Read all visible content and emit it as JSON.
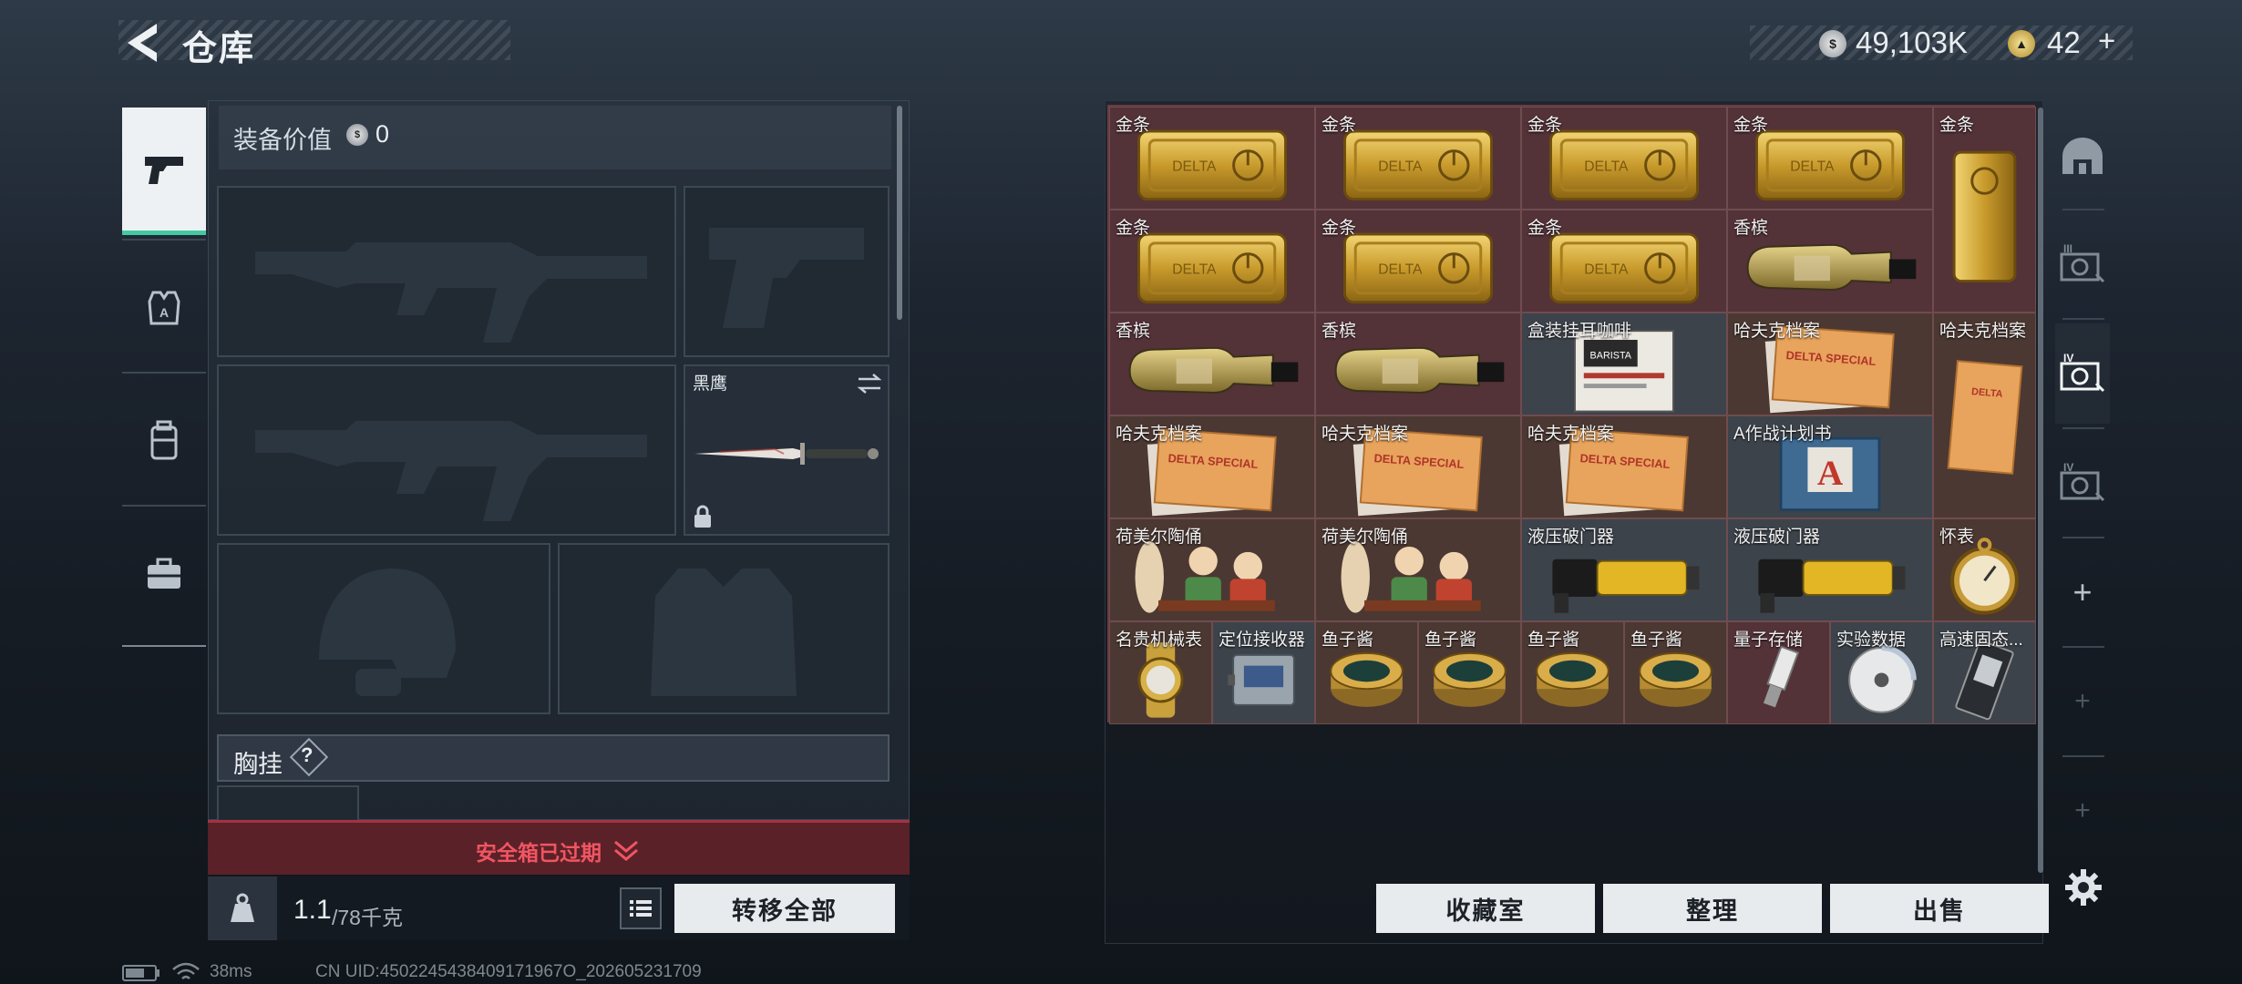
{
  "header": {
    "title": "仓库",
    "currency_1": "49,103K",
    "currency_2": "42",
    "currency_2_suffix": "+"
  },
  "left_tabs": [
    "pistol-icon",
    "vest-icon",
    "backpack-icon",
    "case-icon"
  ],
  "equipment": {
    "value_label": "装备价值",
    "value": "0",
    "melee_name": "黑鹰",
    "chest_rig_label": "胸挂",
    "chest_rig_help": "?"
  },
  "safe_box": {
    "status": "安全箱已过期"
  },
  "weight": {
    "current": "1.1",
    "max": "/78千克"
  },
  "buttons": {
    "transfer_all": "转移全部",
    "collection": "收藏室",
    "sort": "整理",
    "sell": "出售"
  },
  "status_bar": {
    "ping": "38ms",
    "uid": "CN UID:4502245438409171967O_202605231709"
  },
  "storage_items": [
    {
      "name": "金条",
      "art": "goldbar"
    },
    {
      "name": "金条",
      "art": "goldbar"
    },
    {
      "name": "金条",
      "art": "goldbar"
    },
    {
      "name": "金条",
      "art": "goldbar"
    },
    {
      "name": "金条",
      "art": "goldbar-v"
    },
    {
      "name": "金条",
      "art": "goldbar"
    },
    {
      "name": "金条",
      "art": "goldbar"
    },
    {
      "name": "金条",
      "art": "goldbar"
    },
    {
      "name": "香槟",
      "art": "bottle"
    },
    {
      "name": "香槟",
      "art": "bottle"
    },
    {
      "name": "香槟",
      "art": "bottle"
    },
    {
      "name": "盒装挂耳咖啡",
      "art": "coffee"
    },
    {
      "name": "哈夫克档案",
      "art": "folder"
    },
    {
      "name": "哈夫克档案",
      "art": "folder-v"
    },
    {
      "name": "哈夫克档案",
      "art": "folder"
    },
    {
      "name": "哈夫克档案",
      "art": "folder"
    },
    {
      "name": "哈夫克档案",
      "art": "folder"
    },
    {
      "name": "A作战计划书",
      "art": "plan"
    },
    {
      "name": "荷美尔陶俑",
      "art": "figurine"
    },
    {
      "name": "荷美尔陶俑",
      "art": "figurine"
    },
    {
      "name": "液压破门器",
      "art": "breacher"
    },
    {
      "name": "液压破门器",
      "art": "breacher"
    },
    {
      "name": "怀表",
      "art": "pocketwatch"
    },
    {
      "name": "名贵机械表",
      "art": "watch"
    },
    {
      "name": "定位接收器",
      "art": "receiver"
    },
    {
      "name": "鱼子酱",
      "art": "caviar"
    },
    {
      "name": "鱼子酱",
      "art": "caviar"
    },
    {
      "name": "鱼子酱",
      "art": "caviar"
    },
    {
      "name": "鱼子酱",
      "art": "caviar"
    },
    {
      "name": "量子存储",
      "art": "usb"
    },
    {
      "name": "实验数据",
      "art": "disc"
    },
    {
      "name": "高速固态...",
      "art": "ssd"
    }
  ],
  "right_rail": {
    "tabs": [
      "dome-icon",
      "level-3-icon",
      "level-4-icon",
      "level-4-icon"
    ],
    "add": "+"
  }
}
